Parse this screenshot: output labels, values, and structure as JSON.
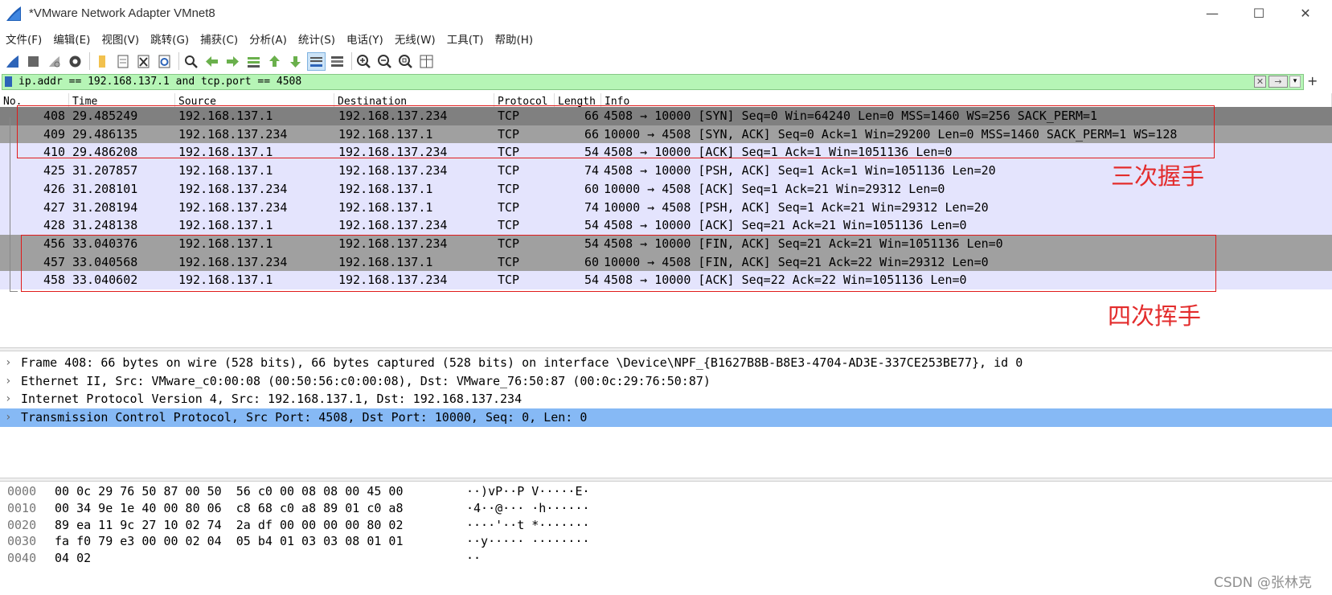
{
  "window": {
    "title": "*VMware Network Adapter VMnet8",
    "minimize_glyph": "—",
    "maximize_glyph": "☐",
    "close_glyph": "✕"
  },
  "menu": [
    "文件(F)",
    "编辑(E)",
    "视图(V)",
    "跳转(G)",
    "捕获(C)",
    "分析(A)",
    "统计(S)",
    "电话(Y)",
    "无线(W)",
    "工具(T)",
    "帮助(H)"
  ],
  "toolbar": {
    "icons": [
      "start-capture-icon",
      "stop-capture-icon",
      "restart-capture-icon",
      "capture-options-icon",
      "open-file-icon",
      "save-file-icon",
      "close-file-icon",
      "reload-file-icon",
      "find-packet-icon",
      "go-back-icon",
      "go-forward-icon",
      "go-to-packet-icon",
      "go-first-icon",
      "go-last-icon",
      "auto-scroll-icon",
      "colorize-icon",
      "zoom-in-icon",
      "zoom-out-icon",
      "zoom-normal-icon",
      "resize-columns-icon"
    ],
    "accent": "#2d64b8"
  },
  "filter": {
    "value": "ip.addr == 192.168.137.1 and tcp.port == 4508",
    "background": "#b6f5b6",
    "clear_glyph": "✕",
    "apply_glyph": "→",
    "dropdown_glyph": "▾",
    "add_glyph": "+"
  },
  "packet_list": {
    "columns": [
      "No.",
      "Time",
      "Source",
      "Destination",
      "Protocol",
      "Length",
      "Info"
    ],
    "rows": [
      {
        "no": "408",
        "time": "29.485249",
        "src": "192.168.137.1",
        "dst": "192.168.137.234",
        "proto": "TCP",
        "len": "66",
        "info": "4508 → 10000 [SYN] Seq=0 Win=64240 Len=0 MSS=1460 WS=256 SACK_PERM=1",
        "style": "selected"
      },
      {
        "no": "409",
        "time": "29.486135",
        "src": "192.168.137.234",
        "dst": "192.168.137.1",
        "proto": "TCP",
        "len": "66",
        "info": "10000 → 4508 [SYN, ACK] Seq=0 Ack=1 Win=29200 Len=0 MSS=1460 SACK_PERM=1 WS=128",
        "style": "gray"
      },
      {
        "no": "410",
        "time": "29.486208",
        "src": "192.168.137.1",
        "dst": "192.168.137.234",
        "proto": "TCP",
        "len": "54",
        "info": "4508 → 10000 [ACK] Seq=1 Ack=1 Win=1051136 Len=0",
        "style": "light"
      },
      {
        "no": "425",
        "time": "31.207857",
        "src": "192.168.137.1",
        "dst": "192.168.137.234",
        "proto": "TCP",
        "len": "74",
        "info": "4508 → 10000 [PSH, ACK] Seq=1 Ack=1 Win=1051136 Len=20",
        "style": "light"
      },
      {
        "no": "426",
        "time": "31.208101",
        "src": "192.168.137.234",
        "dst": "192.168.137.1",
        "proto": "TCP",
        "len": "60",
        "info": "10000 → 4508 [ACK] Seq=1 Ack=21 Win=29312 Len=0",
        "style": "light"
      },
      {
        "no": "427",
        "time": "31.208194",
        "src": "192.168.137.234",
        "dst": "192.168.137.1",
        "proto": "TCP",
        "len": "74",
        "info": "10000 → 4508 [PSH, ACK] Seq=1 Ack=21 Win=29312 Len=20",
        "style": "light"
      },
      {
        "no": "428",
        "time": "31.248138",
        "src": "192.168.137.1",
        "dst": "192.168.137.234",
        "proto": "TCP",
        "len": "54",
        "info": "4508 → 10000 [ACK] Seq=21 Ack=21 Win=1051136 Len=0",
        "style": "light"
      },
      {
        "no": "456",
        "time": "33.040376",
        "src": "192.168.137.1",
        "dst": "192.168.137.234",
        "proto": "TCP",
        "len": "54",
        "info": "4508 → 10000 [FIN, ACK] Seq=21 Ack=21 Win=1051136 Len=0",
        "style": "gray"
      },
      {
        "no": "457",
        "time": "33.040568",
        "src": "192.168.137.234",
        "dst": "192.168.137.1",
        "proto": "TCP",
        "len": "60",
        "info": "10000 → 4508 [FIN, ACK] Seq=21 Ack=22 Win=29312 Len=0",
        "style": "gray"
      },
      {
        "no": "458",
        "time": "33.040602",
        "src": "192.168.137.1",
        "dst": "192.168.137.234",
        "proto": "TCP",
        "len": "54",
        "info": "4508 → 10000 [ACK] Seq=22 Ack=22 Win=1051136 Len=0",
        "style": "light"
      }
    ],
    "row_colors": {
      "selected": "#808080",
      "gray": "#a0a0a0",
      "light": "#e4e4fd"
    }
  },
  "annotations": {
    "handshake_label": "三次握手",
    "teardown_label": "四次挥手",
    "color": "#e01b1b"
  },
  "details": {
    "arrow_glyph": "›",
    "rows": [
      "Frame 408: 66 bytes on wire (528 bits), 66 bytes captured (528 bits) on interface \\Device\\NPF_{B1627B8B-B8E3-4704-AD3E-337CE253BE77}, id 0",
      "Ethernet II, Src: VMware_c0:00:08 (00:50:56:c0:00:08), Dst: VMware_76:50:87 (00:0c:29:76:50:87)",
      "Internet Protocol Version 4, Src: 192.168.137.1, Dst: 192.168.137.234",
      "Transmission Control Protocol, Src Port: 4508, Dst Port: 10000, Seq: 0, Len: 0"
    ],
    "selected_index": 3,
    "selected_color": "#86b9f5"
  },
  "bytes": {
    "rows": [
      {
        "offset": "0000",
        "hex": "00 0c 29 76 50 87 00 50  56 c0 00 08 08 00 45 00",
        "ascii": "··)vP··P V·····E·"
      },
      {
        "offset": "0010",
        "hex": "00 34 9e 1e 40 00 80 06  c8 68 c0 a8 89 01 c0 a8",
        "ascii": "·4··@··· ·h······"
      },
      {
        "offset": "0020",
        "hex": "89 ea 11 9c 27 10 02 74  2a df 00 00 00 00 80 02",
        "ascii": "····'··t *·······"
      },
      {
        "offset": "0030",
        "hex": "fa f0 79 e3 00 00 02 04  05 b4 01 03 03 08 01 01",
        "ascii": "··y····· ········"
      },
      {
        "offset": "0040",
        "hex": "04 02",
        "ascii": "··"
      }
    ]
  },
  "watermark": "CSDN @张林克"
}
